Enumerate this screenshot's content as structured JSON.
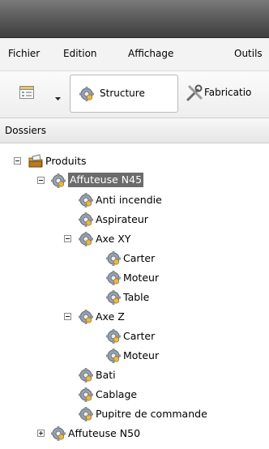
{
  "menu": {
    "items": [
      "Fichier",
      "Edition",
      "Affichage",
      "Outils"
    ]
  },
  "toolbar": {
    "structure_label": "Structure",
    "fabrication_label": "Fabricatio"
  },
  "folders": {
    "header": "Dossiers"
  },
  "tree": {
    "root": "Produits",
    "n45": "Affuteuse N45",
    "anti_incendie": "Anti incendie",
    "aspirateur": "Aspirateur",
    "axe_xy": "Axe XY",
    "xy_carter": "Carter",
    "xy_moteur": "Moteur",
    "xy_table": "Table",
    "axe_z": "Axe Z",
    "z_carter": "Carter",
    "z_moteur": "Moteur",
    "bati": "Bati",
    "cablage": "Cablage",
    "pupitre": "Pupitre de commande",
    "n50": "Affuteuse N50"
  },
  "colors": {
    "selection": "#6b6b6b",
    "titlebar": "#5a5a5a"
  }
}
